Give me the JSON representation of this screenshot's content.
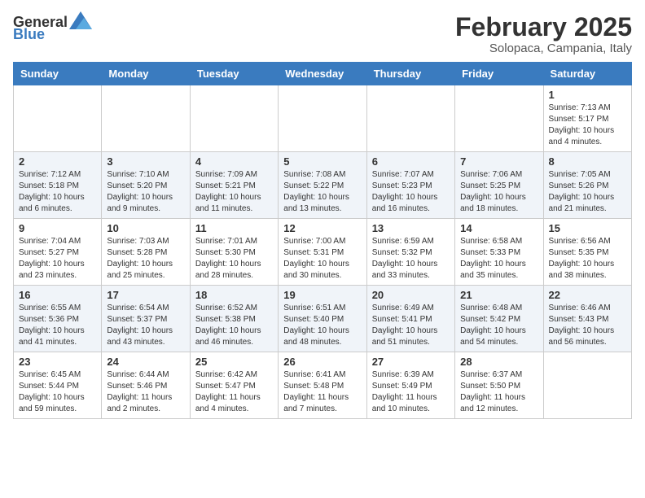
{
  "header": {
    "logo_general": "General",
    "logo_blue": "Blue",
    "month": "February 2025",
    "location": "Solopaca, Campania, Italy"
  },
  "days_of_week": [
    "Sunday",
    "Monday",
    "Tuesday",
    "Wednesday",
    "Thursday",
    "Friday",
    "Saturday"
  ],
  "weeks": [
    [
      {
        "day": "",
        "info": ""
      },
      {
        "day": "",
        "info": ""
      },
      {
        "day": "",
        "info": ""
      },
      {
        "day": "",
        "info": ""
      },
      {
        "day": "",
        "info": ""
      },
      {
        "day": "",
        "info": ""
      },
      {
        "day": "1",
        "info": "Sunrise: 7:13 AM\nSunset: 5:17 PM\nDaylight: 10 hours and 4 minutes."
      }
    ],
    [
      {
        "day": "2",
        "info": "Sunrise: 7:12 AM\nSunset: 5:18 PM\nDaylight: 10 hours and 6 minutes."
      },
      {
        "day": "3",
        "info": "Sunrise: 7:10 AM\nSunset: 5:20 PM\nDaylight: 10 hours and 9 minutes."
      },
      {
        "day": "4",
        "info": "Sunrise: 7:09 AM\nSunset: 5:21 PM\nDaylight: 10 hours and 11 minutes."
      },
      {
        "day": "5",
        "info": "Sunrise: 7:08 AM\nSunset: 5:22 PM\nDaylight: 10 hours and 13 minutes."
      },
      {
        "day": "6",
        "info": "Sunrise: 7:07 AM\nSunset: 5:23 PM\nDaylight: 10 hours and 16 minutes."
      },
      {
        "day": "7",
        "info": "Sunrise: 7:06 AM\nSunset: 5:25 PM\nDaylight: 10 hours and 18 minutes."
      },
      {
        "day": "8",
        "info": "Sunrise: 7:05 AM\nSunset: 5:26 PM\nDaylight: 10 hours and 21 minutes."
      }
    ],
    [
      {
        "day": "9",
        "info": "Sunrise: 7:04 AM\nSunset: 5:27 PM\nDaylight: 10 hours and 23 minutes."
      },
      {
        "day": "10",
        "info": "Sunrise: 7:03 AM\nSunset: 5:28 PM\nDaylight: 10 hours and 25 minutes."
      },
      {
        "day": "11",
        "info": "Sunrise: 7:01 AM\nSunset: 5:30 PM\nDaylight: 10 hours and 28 minutes."
      },
      {
        "day": "12",
        "info": "Sunrise: 7:00 AM\nSunset: 5:31 PM\nDaylight: 10 hours and 30 minutes."
      },
      {
        "day": "13",
        "info": "Sunrise: 6:59 AM\nSunset: 5:32 PM\nDaylight: 10 hours and 33 minutes."
      },
      {
        "day": "14",
        "info": "Sunrise: 6:58 AM\nSunset: 5:33 PM\nDaylight: 10 hours and 35 minutes."
      },
      {
        "day": "15",
        "info": "Sunrise: 6:56 AM\nSunset: 5:35 PM\nDaylight: 10 hours and 38 minutes."
      }
    ],
    [
      {
        "day": "16",
        "info": "Sunrise: 6:55 AM\nSunset: 5:36 PM\nDaylight: 10 hours and 41 minutes."
      },
      {
        "day": "17",
        "info": "Sunrise: 6:54 AM\nSunset: 5:37 PM\nDaylight: 10 hours and 43 minutes."
      },
      {
        "day": "18",
        "info": "Sunrise: 6:52 AM\nSunset: 5:38 PM\nDaylight: 10 hours and 46 minutes."
      },
      {
        "day": "19",
        "info": "Sunrise: 6:51 AM\nSunset: 5:40 PM\nDaylight: 10 hours and 48 minutes."
      },
      {
        "day": "20",
        "info": "Sunrise: 6:49 AM\nSunset: 5:41 PM\nDaylight: 10 hours and 51 minutes."
      },
      {
        "day": "21",
        "info": "Sunrise: 6:48 AM\nSunset: 5:42 PM\nDaylight: 10 hours and 54 minutes."
      },
      {
        "day": "22",
        "info": "Sunrise: 6:46 AM\nSunset: 5:43 PM\nDaylight: 10 hours and 56 minutes."
      }
    ],
    [
      {
        "day": "23",
        "info": "Sunrise: 6:45 AM\nSunset: 5:44 PM\nDaylight: 10 hours and 59 minutes."
      },
      {
        "day": "24",
        "info": "Sunrise: 6:44 AM\nSunset: 5:46 PM\nDaylight: 11 hours and 2 minutes."
      },
      {
        "day": "25",
        "info": "Sunrise: 6:42 AM\nSunset: 5:47 PM\nDaylight: 11 hours and 4 minutes."
      },
      {
        "day": "26",
        "info": "Sunrise: 6:41 AM\nSunset: 5:48 PM\nDaylight: 11 hours and 7 minutes."
      },
      {
        "day": "27",
        "info": "Sunrise: 6:39 AM\nSunset: 5:49 PM\nDaylight: 11 hours and 10 minutes."
      },
      {
        "day": "28",
        "info": "Sunrise: 6:37 AM\nSunset: 5:50 PM\nDaylight: 11 hours and 12 minutes."
      },
      {
        "day": "",
        "info": ""
      }
    ]
  ]
}
